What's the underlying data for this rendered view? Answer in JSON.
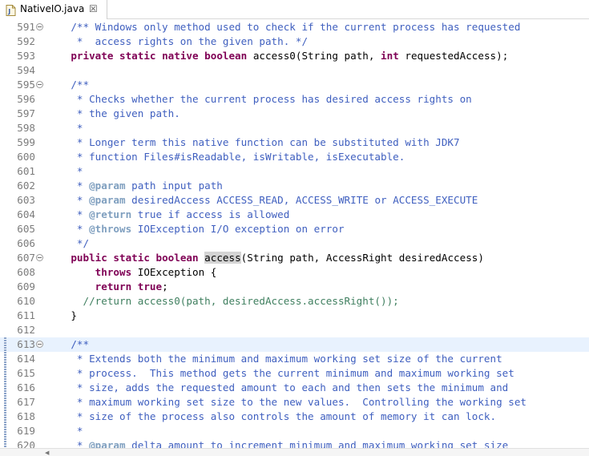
{
  "tab": {
    "title": "NativeIO.java",
    "close": "☒",
    "icon": "java-file-icon"
  },
  "gutter": {
    "fold_icon": "fold-toggle-icon",
    "ruler": "quick-diff-change-marker"
  },
  "colors": {
    "comment": "#3f5fbf",
    "keyword": "#7f0055",
    "javadoc_tag": "#7f9fbf",
    "line_comment": "#3f7f5f",
    "current_line": "#e8f2fe"
  },
  "lines": [
    {
      "num": "591",
      "fold": true,
      "ruler": false,
      "hl": false,
      "segs": [
        {
          "c": "c",
          "t": "    /** Windows only method used to check if the current process has requested"
        }
      ]
    },
    {
      "num": "592",
      "fold": false,
      "ruler": false,
      "hl": false,
      "segs": [
        {
          "c": "c",
          "t": "     *  access rights on the given path. */"
        }
      ]
    },
    {
      "num": "593",
      "fold": false,
      "ruler": false,
      "hl": false,
      "segs": [
        {
          "c": "",
          "t": "    "
        },
        {
          "c": "k",
          "t": "private static native boolean"
        },
        {
          "c": "",
          "t": " access0(String path, "
        },
        {
          "c": "k",
          "t": "int"
        },
        {
          "c": "",
          "t": " requestedAccess);"
        }
      ]
    },
    {
      "num": "594",
      "fold": false,
      "ruler": false,
      "hl": false,
      "segs": []
    },
    {
      "num": "595",
      "fold": true,
      "ruler": false,
      "hl": false,
      "segs": [
        {
          "c": "c",
          "t": "    /**"
        }
      ]
    },
    {
      "num": "596",
      "fold": false,
      "ruler": false,
      "hl": false,
      "segs": [
        {
          "c": "c",
          "t": "     * Checks whether the current process has desired access rights on"
        }
      ]
    },
    {
      "num": "597",
      "fold": false,
      "ruler": false,
      "hl": false,
      "segs": [
        {
          "c": "c",
          "t": "     * the given path."
        }
      ]
    },
    {
      "num": "598",
      "fold": false,
      "ruler": false,
      "hl": false,
      "segs": [
        {
          "c": "c",
          "t": "     *"
        }
      ]
    },
    {
      "num": "599",
      "fold": false,
      "ruler": false,
      "hl": false,
      "segs": [
        {
          "c": "c",
          "t": "     * Longer term this native function can be substituted with JDK7"
        }
      ]
    },
    {
      "num": "600",
      "fold": false,
      "ruler": false,
      "hl": false,
      "segs": [
        {
          "c": "c",
          "t": "     * function Files#isReadable, isWritable, isExecutable."
        }
      ]
    },
    {
      "num": "601",
      "fold": false,
      "ruler": false,
      "hl": false,
      "segs": [
        {
          "c": "c",
          "t": "     *"
        }
      ]
    },
    {
      "num": "602",
      "fold": false,
      "ruler": false,
      "hl": false,
      "segs": [
        {
          "c": "c",
          "t": "     * "
        },
        {
          "c": "t",
          "t": "@param"
        },
        {
          "c": "c",
          "t": " path input path"
        }
      ]
    },
    {
      "num": "603",
      "fold": false,
      "ruler": false,
      "hl": false,
      "segs": [
        {
          "c": "c",
          "t": "     * "
        },
        {
          "c": "t",
          "t": "@param"
        },
        {
          "c": "c",
          "t": " desiredAccess ACCESS_READ, ACCESS_WRITE or ACCESS_EXECUTE"
        }
      ]
    },
    {
      "num": "604",
      "fold": false,
      "ruler": false,
      "hl": false,
      "segs": [
        {
          "c": "c",
          "t": "     * "
        },
        {
          "c": "t",
          "t": "@return"
        },
        {
          "c": "c",
          "t": " true if access is allowed"
        }
      ]
    },
    {
      "num": "605",
      "fold": false,
      "ruler": false,
      "hl": false,
      "segs": [
        {
          "c": "c",
          "t": "     * "
        },
        {
          "c": "t",
          "t": "@throws"
        },
        {
          "c": "c",
          "t": " IOException I/O exception on error"
        }
      ]
    },
    {
      "num": "606",
      "fold": false,
      "ruler": false,
      "hl": false,
      "segs": [
        {
          "c": "c",
          "t": "     */"
        }
      ]
    },
    {
      "num": "607",
      "fold": true,
      "ruler": false,
      "hl": false,
      "segs": [
        {
          "c": "",
          "t": "    "
        },
        {
          "c": "k",
          "t": "public static boolean"
        },
        {
          "c": "",
          "t": " "
        },
        {
          "c": "sel",
          "t": "access"
        },
        {
          "c": "",
          "t": "(String path, AccessRight desiredAccess)"
        }
      ]
    },
    {
      "num": "608",
      "fold": false,
      "ruler": false,
      "hl": false,
      "segs": [
        {
          "c": "",
          "t": "        "
        },
        {
          "c": "k",
          "t": "throws"
        },
        {
          "c": "",
          "t": " IOException {"
        }
      ]
    },
    {
      "num": "609",
      "fold": false,
      "ruler": false,
      "hl": false,
      "segs": [
        {
          "c": "",
          "t": "        "
        },
        {
          "c": "k",
          "t": "return true"
        },
        {
          "c": "",
          "t": ";"
        }
      ]
    },
    {
      "num": "610",
      "fold": false,
      "ruler": false,
      "hl": false,
      "segs": [
        {
          "c": "lc",
          "t": "      //return access0(path, desiredAccess.accessRight());"
        }
      ]
    },
    {
      "num": "611",
      "fold": false,
      "ruler": false,
      "hl": false,
      "segs": [
        {
          "c": "",
          "t": "    }"
        }
      ]
    },
    {
      "num": "612",
      "fold": false,
      "ruler": false,
      "hl": false,
      "segs": []
    },
    {
      "num": "613",
      "fold": true,
      "ruler": true,
      "hl": true,
      "segs": [
        {
          "c": "c",
          "t": "    /**"
        }
      ]
    },
    {
      "num": "614",
      "fold": false,
      "ruler": true,
      "hl": false,
      "segs": [
        {
          "c": "c",
          "t": "     * Extends both the minimum and maximum working set size of the current"
        }
      ]
    },
    {
      "num": "615",
      "fold": false,
      "ruler": true,
      "hl": false,
      "segs": [
        {
          "c": "c",
          "t": "     * process.  This method gets the current minimum and maximum working set"
        }
      ]
    },
    {
      "num": "616",
      "fold": false,
      "ruler": true,
      "hl": false,
      "segs": [
        {
          "c": "c",
          "t": "     * size, adds the requested amount to each and then sets the minimum and"
        }
      ]
    },
    {
      "num": "617",
      "fold": false,
      "ruler": true,
      "hl": false,
      "segs": [
        {
          "c": "c",
          "t": "     * maximum working set size to the new values.  Controlling the working set"
        }
      ]
    },
    {
      "num": "618",
      "fold": false,
      "ruler": true,
      "hl": false,
      "segs": [
        {
          "c": "c",
          "t": "     * size of the process also controls the amount of memory it can lock."
        }
      ]
    },
    {
      "num": "619",
      "fold": false,
      "ruler": true,
      "hl": false,
      "segs": [
        {
          "c": "c",
          "t": "     *"
        }
      ]
    },
    {
      "num": "620",
      "fold": false,
      "ruler": true,
      "hl": false,
      "segs": [
        {
          "c": "c",
          "t": "     * "
        },
        {
          "c": "t",
          "t": "@param"
        },
        {
          "c": "c",
          "t": " delta amount to increment minimum and maximum working set size"
        }
      ]
    }
  ]
}
